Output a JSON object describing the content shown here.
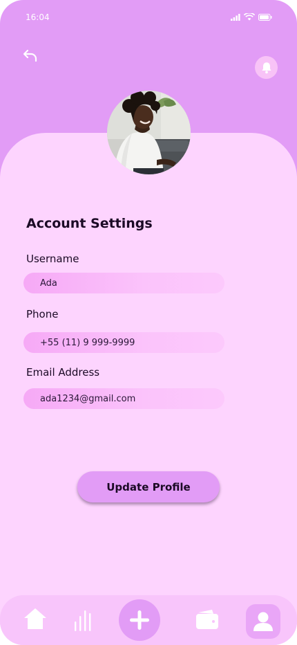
{
  "status_bar": {
    "time": "16:04"
  },
  "header": {
    "back_icon": "back-arrow-icon",
    "notification_icon": "bell-icon"
  },
  "profile": {
    "avatar_alt": "Profile photo"
  },
  "form": {
    "title": "Account Settings",
    "fields": [
      {
        "label": "Username",
        "value": "Ada"
      },
      {
        "label": "Phone",
        "value": "+55 (11) 9 999-9999"
      },
      {
        "label": "Email Address",
        "value": "ada1234@gmail.com"
      }
    ],
    "submit_label": "Update Profile"
  },
  "bottom_nav": {
    "items": [
      {
        "icon": "home-icon"
      },
      {
        "icon": "stats-icon"
      },
      {
        "icon": "add-icon"
      },
      {
        "icon": "wallet-icon"
      },
      {
        "icon": "profile-icon"
      }
    ]
  },
  "colors": {
    "header_bg": "#e29cf6",
    "sheet_bg": "#fdd4fe",
    "field_bg": "#f8b6f8",
    "text": "#1b0a25",
    "nav_bg": "#f8c5fb"
  }
}
